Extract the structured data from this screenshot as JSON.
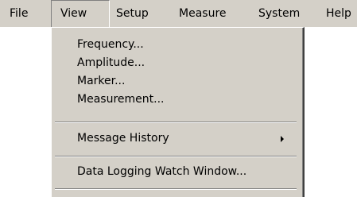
{
  "menubar": {
    "items": [
      {
        "label": "File"
      },
      {
        "label": "View"
      },
      {
        "label": "Setup"
      },
      {
        "label": "Measure"
      },
      {
        "label": "System"
      },
      {
        "label": "Help"
      }
    ],
    "active": "View"
  },
  "view_menu": {
    "items": [
      {
        "label": "Frequency..."
      },
      {
        "label": "Amplitude..."
      },
      {
        "label": "Marker..."
      },
      {
        "label": "Measurement..."
      },
      {
        "label": "Message History",
        "submenu": true
      },
      {
        "label": "Data Logging Watch Window..."
      }
    ]
  },
  "icons": {
    "submenu_arrow": "chevron-right-icon"
  }
}
